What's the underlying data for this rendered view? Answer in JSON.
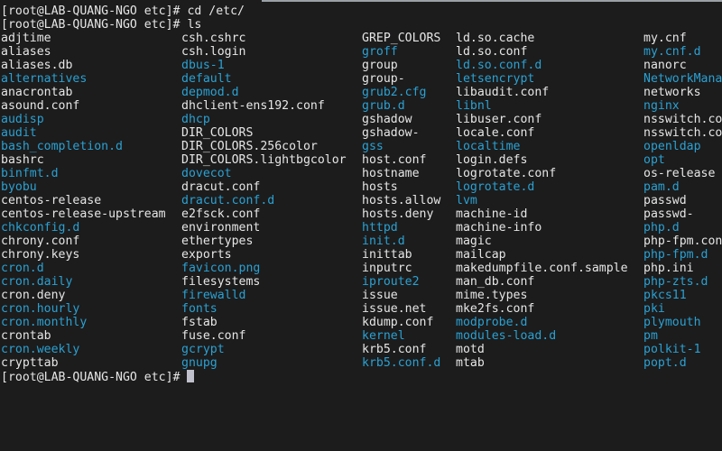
{
  "terminal": {
    "prompt": "[root@LAB-QUANG-NGO etc]# ",
    "history": [
      {
        "prompt": "[root@LAB-QUANG-NGO etc]# ",
        "command": "cd /etc/"
      },
      {
        "prompt": "[root@LAB-QUANG-NGO etc]# ",
        "command": "ls"
      }
    ],
    "current_input": "",
    "colors": {
      "background": "#1c1c1c",
      "text": "#e6e6e6",
      "directory": "#2aa1d3",
      "cursor": "#c0c0cc"
    },
    "columns": [
      [
        {
          "name": "adjtime",
          "type": "file"
        },
        {
          "name": "aliases",
          "type": "file"
        },
        {
          "name": "aliases.db",
          "type": "file"
        },
        {
          "name": "alternatives",
          "type": "dir"
        },
        {
          "name": "anacrontab",
          "type": "file"
        },
        {
          "name": "asound.conf",
          "type": "file"
        },
        {
          "name": "audisp",
          "type": "dir"
        },
        {
          "name": "audit",
          "type": "dir"
        },
        {
          "name": "bash_completion.d",
          "type": "dir"
        },
        {
          "name": "bashrc",
          "type": "file"
        },
        {
          "name": "binfmt.d",
          "type": "dir"
        },
        {
          "name": "byobu",
          "type": "dir"
        },
        {
          "name": "centos-release",
          "type": "file"
        },
        {
          "name": "centos-release-upstream",
          "type": "file"
        },
        {
          "name": "chkconfig.d",
          "type": "dir"
        },
        {
          "name": "chrony.conf",
          "type": "file"
        },
        {
          "name": "chrony.keys",
          "type": "file"
        },
        {
          "name": "cron.d",
          "type": "dir"
        },
        {
          "name": "cron.daily",
          "type": "dir"
        },
        {
          "name": "cron.deny",
          "type": "file"
        },
        {
          "name": "cron.hourly",
          "type": "dir"
        },
        {
          "name": "cron.monthly",
          "type": "dir"
        },
        {
          "name": "crontab",
          "type": "file"
        },
        {
          "name": "cron.weekly",
          "type": "dir"
        },
        {
          "name": "crypttab",
          "type": "file"
        }
      ],
      [
        {
          "name": "csh.cshrc",
          "type": "file"
        },
        {
          "name": "csh.login",
          "type": "file"
        },
        {
          "name": "dbus-1",
          "type": "dir"
        },
        {
          "name": "default",
          "type": "dir"
        },
        {
          "name": "depmod.d",
          "type": "dir"
        },
        {
          "name": "dhclient-ens192.conf",
          "type": "file"
        },
        {
          "name": "dhcp",
          "type": "dir"
        },
        {
          "name": "DIR_COLORS",
          "type": "file"
        },
        {
          "name": "DIR_COLORS.256color",
          "type": "file"
        },
        {
          "name": "DIR_COLORS.lightbgcolor",
          "type": "file"
        },
        {
          "name": "dovecot",
          "type": "dir"
        },
        {
          "name": "dracut.conf",
          "type": "file"
        },
        {
          "name": "dracut.conf.d",
          "type": "dir"
        },
        {
          "name": "e2fsck.conf",
          "type": "file"
        },
        {
          "name": "environment",
          "type": "file"
        },
        {
          "name": "ethertypes",
          "type": "file"
        },
        {
          "name": "exports",
          "type": "file"
        },
        {
          "name": "favicon.png",
          "type": "dir"
        },
        {
          "name": "filesystems",
          "type": "file"
        },
        {
          "name": "firewalld",
          "type": "dir"
        },
        {
          "name": "fonts",
          "type": "dir"
        },
        {
          "name": "fstab",
          "type": "file"
        },
        {
          "name": "fuse.conf",
          "type": "file"
        },
        {
          "name": "gcrypt",
          "type": "dir"
        },
        {
          "name": "gnupg",
          "type": "dir"
        }
      ],
      [
        {
          "name": "GREP_COLORS",
          "type": "file"
        },
        {
          "name": "groff",
          "type": "dir"
        },
        {
          "name": "group",
          "type": "file"
        },
        {
          "name": "group-",
          "type": "file"
        },
        {
          "name": "grub2.cfg",
          "type": "dir"
        },
        {
          "name": "grub.d",
          "type": "dir"
        },
        {
          "name": "gshadow",
          "type": "file"
        },
        {
          "name": "gshadow-",
          "type": "file"
        },
        {
          "name": "gss",
          "type": "dir"
        },
        {
          "name": "host.conf",
          "type": "file"
        },
        {
          "name": "hostname",
          "type": "file"
        },
        {
          "name": "hosts",
          "type": "file"
        },
        {
          "name": "hosts.allow",
          "type": "file"
        },
        {
          "name": "hosts.deny",
          "type": "file"
        },
        {
          "name": "httpd",
          "type": "dir"
        },
        {
          "name": "init.d",
          "type": "dir"
        },
        {
          "name": "inittab",
          "type": "file"
        },
        {
          "name": "inputrc",
          "type": "file"
        },
        {
          "name": "iproute2",
          "type": "dir"
        },
        {
          "name": "issue",
          "type": "file"
        },
        {
          "name": "issue.net",
          "type": "file"
        },
        {
          "name": "kdump.conf",
          "type": "file"
        },
        {
          "name": "kernel",
          "type": "dir"
        },
        {
          "name": "krb5.conf",
          "type": "file"
        },
        {
          "name": "krb5.conf.d",
          "type": "dir"
        }
      ],
      [
        {
          "name": "ld.so.cache",
          "type": "file"
        },
        {
          "name": "ld.so.conf",
          "type": "file"
        },
        {
          "name": "ld.so.conf.d",
          "type": "dir"
        },
        {
          "name": "letsencrypt",
          "type": "dir"
        },
        {
          "name": "libaudit.conf",
          "type": "file"
        },
        {
          "name": "libnl",
          "type": "dir"
        },
        {
          "name": "libuser.conf",
          "type": "file"
        },
        {
          "name": "locale.conf",
          "type": "file"
        },
        {
          "name": "localtime",
          "type": "dir"
        },
        {
          "name": "login.defs",
          "type": "file"
        },
        {
          "name": "logrotate.conf",
          "type": "file"
        },
        {
          "name": "logrotate.d",
          "type": "dir"
        },
        {
          "name": "lvm",
          "type": "dir"
        },
        {
          "name": "machine-id",
          "type": "file"
        },
        {
          "name": "machine-info",
          "type": "file"
        },
        {
          "name": "magic",
          "type": "file"
        },
        {
          "name": "mailcap",
          "type": "file"
        },
        {
          "name": "makedumpfile.conf.sample",
          "type": "file"
        },
        {
          "name": "man_db.conf",
          "type": "file"
        },
        {
          "name": "mime.types",
          "type": "file"
        },
        {
          "name": "mke2fs.conf",
          "type": "file"
        },
        {
          "name": "modprobe.d",
          "type": "dir"
        },
        {
          "name": "modules-load.d",
          "type": "dir"
        },
        {
          "name": "motd",
          "type": "file"
        },
        {
          "name": "mtab",
          "type": "file"
        }
      ],
      [
        {
          "name": "my.cnf",
          "type": "file"
        },
        {
          "name": "my.cnf.d",
          "type": "dir"
        },
        {
          "name": "nanorc",
          "type": "file"
        },
        {
          "name": "NetworkMana",
          "type": "dir"
        },
        {
          "name": "networks",
          "type": "file"
        },
        {
          "name": "nginx",
          "type": "dir"
        },
        {
          "name": "nsswitch.co",
          "type": "file"
        },
        {
          "name": "nsswitch.co",
          "type": "file"
        },
        {
          "name": "openldap",
          "type": "dir"
        },
        {
          "name": "opt",
          "type": "dir"
        },
        {
          "name": "os-release",
          "type": "file"
        },
        {
          "name": "pam.d",
          "type": "dir"
        },
        {
          "name": "passwd",
          "type": "file"
        },
        {
          "name": "passwd-",
          "type": "file"
        },
        {
          "name": "php.d",
          "type": "dir"
        },
        {
          "name": "php-fpm.con",
          "type": "file"
        },
        {
          "name": "php-fpm.d",
          "type": "dir"
        },
        {
          "name": "php.ini",
          "type": "file"
        },
        {
          "name": "php-zts.d",
          "type": "dir"
        },
        {
          "name": "pkcs11",
          "type": "dir"
        },
        {
          "name": "pki",
          "type": "dir"
        },
        {
          "name": "plymouth",
          "type": "dir"
        },
        {
          "name": "pm",
          "type": "dir"
        },
        {
          "name": "polkit-1",
          "type": "dir"
        },
        {
          "name": "popt.d",
          "type": "dir"
        }
      ]
    ]
  }
}
